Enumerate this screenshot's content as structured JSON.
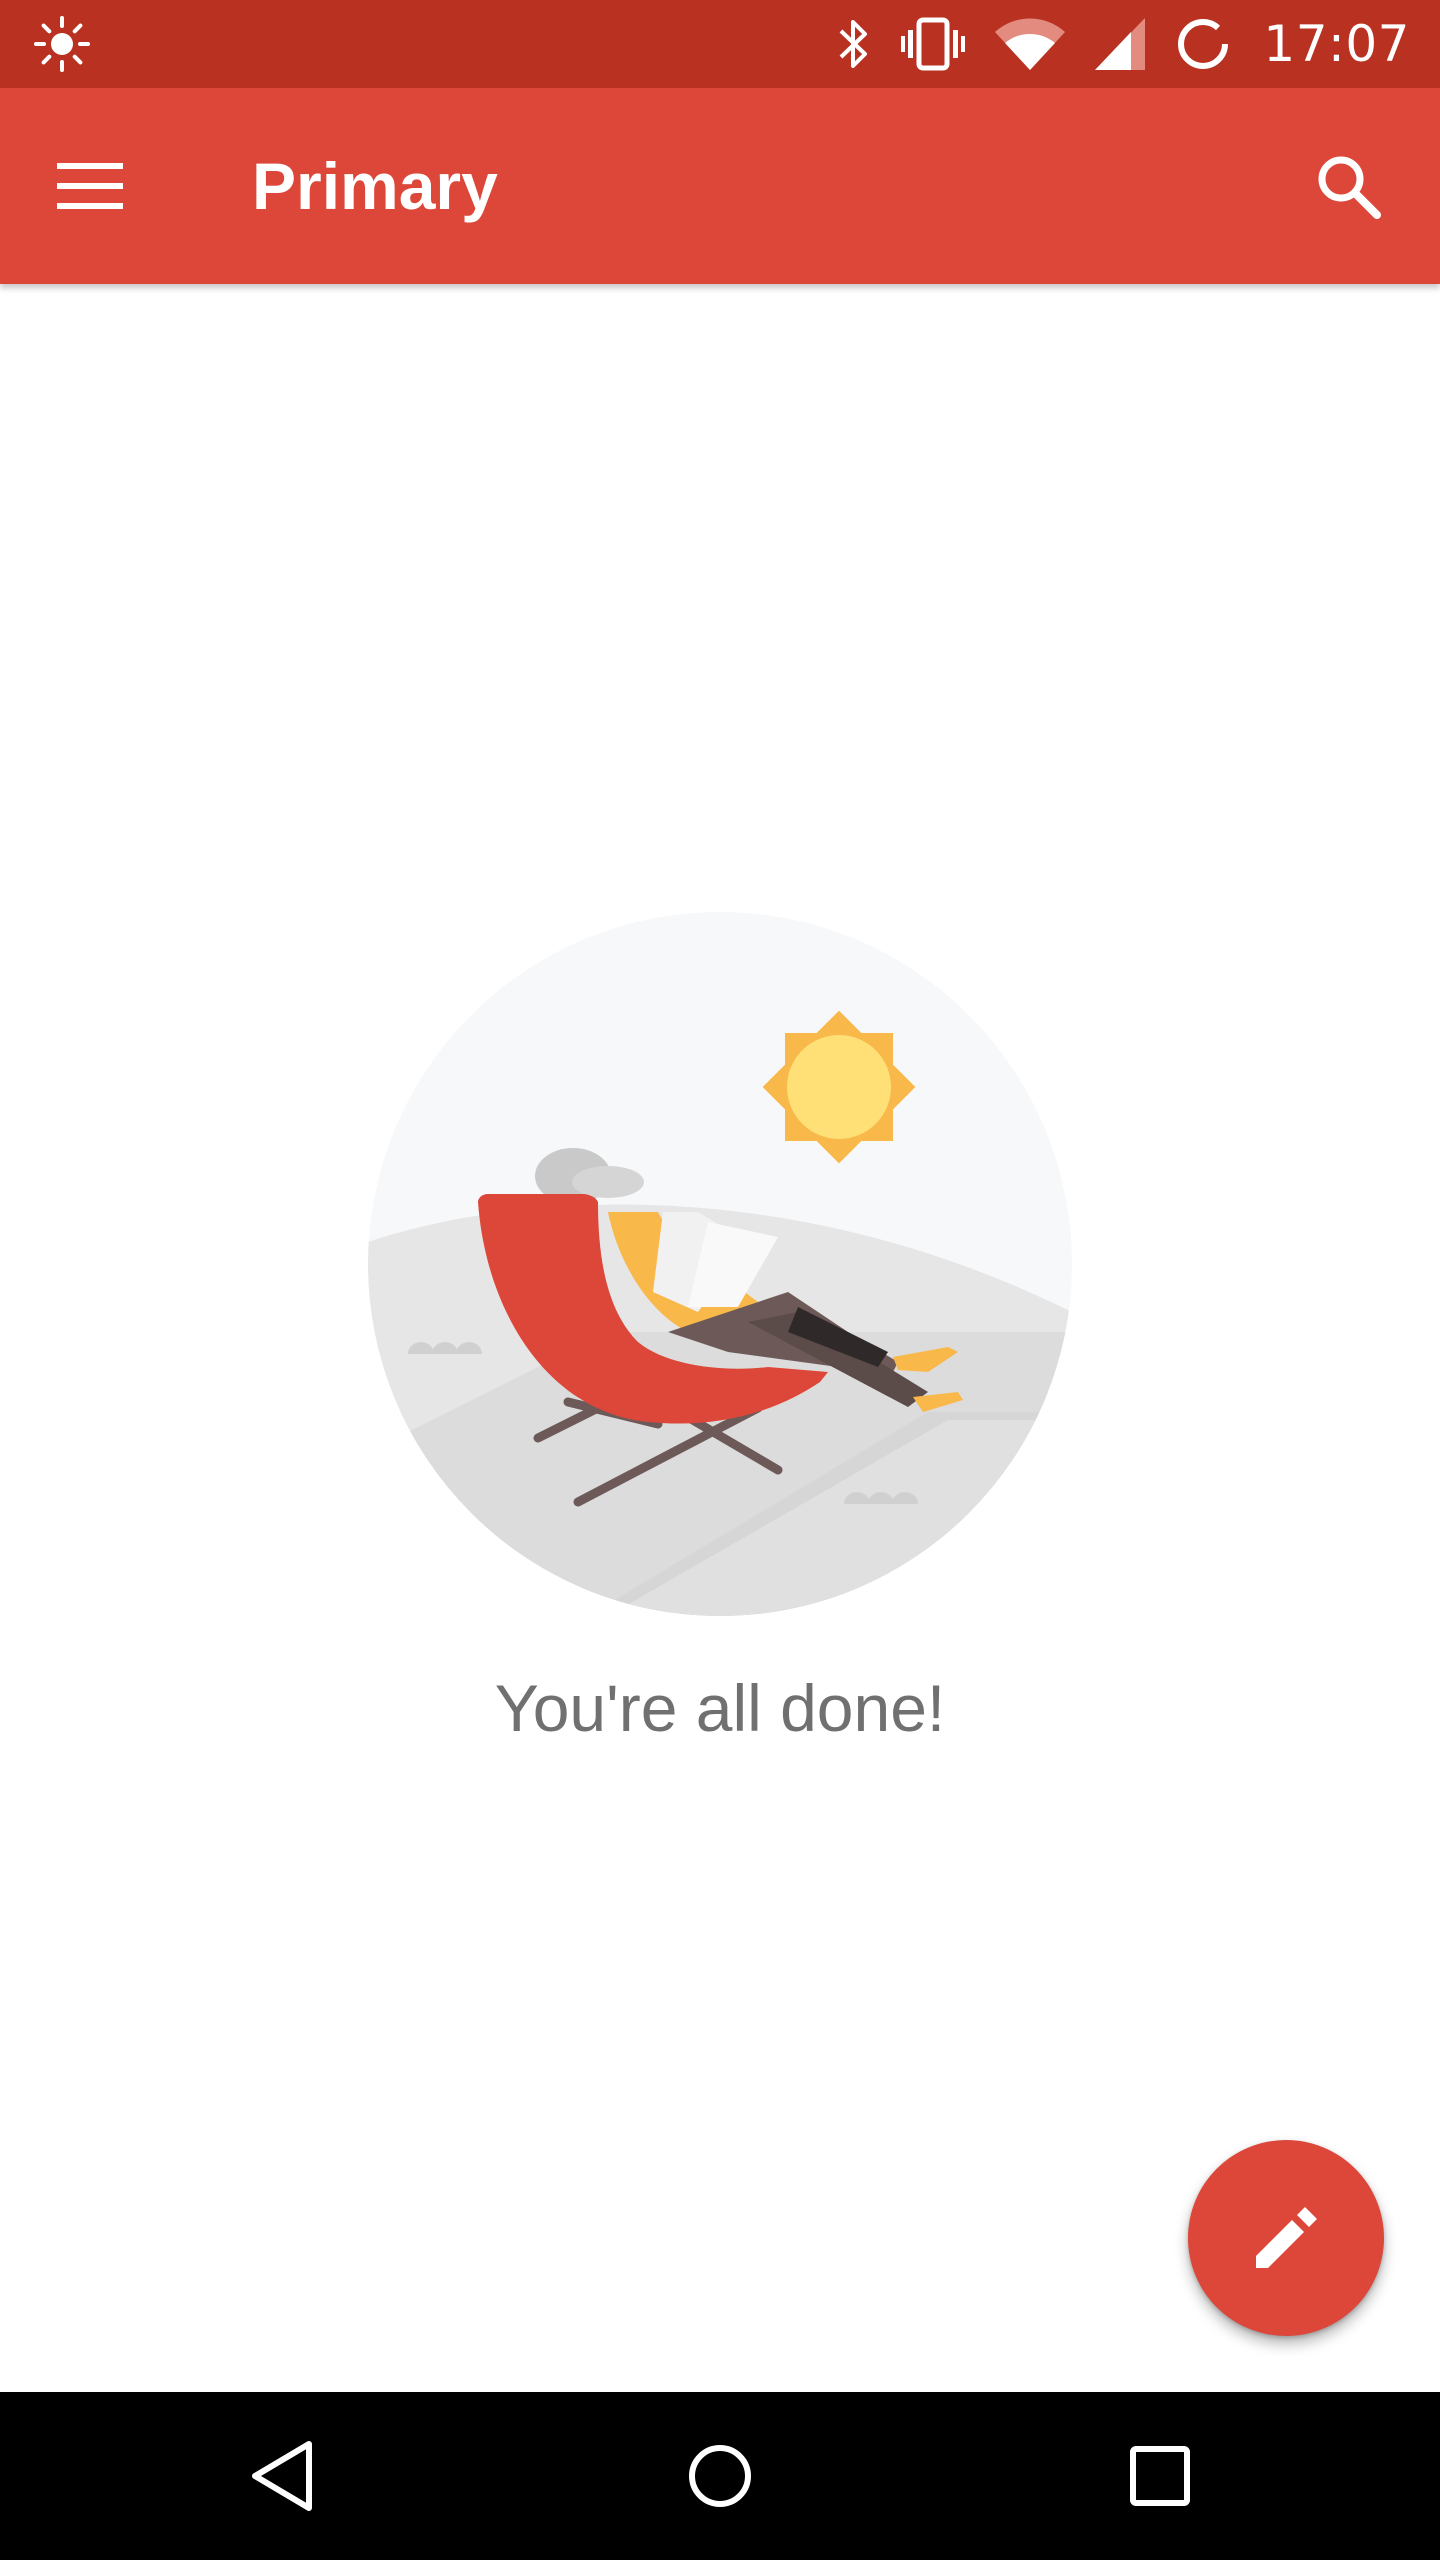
{
  "status_bar": {
    "time": "17:07",
    "left_icon": "brightness-icon",
    "icons": [
      "bluetooth-icon",
      "vibrate-icon",
      "wifi-icon",
      "cell-signal-icon",
      "sync-icon"
    ]
  },
  "app_bar": {
    "title": "Primary",
    "menu_icon": "hamburger-menu-icon",
    "search_icon": "search-icon",
    "color": "#dc473a"
  },
  "empty_state": {
    "message": "You're all done!",
    "illustration": "person-relaxing-in-deck-chair-illustration"
  },
  "fab": {
    "icon": "pencil-icon",
    "color": "#dc473a"
  },
  "nav_bar": {
    "buttons": [
      "back-icon",
      "home-icon",
      "recents-icon"
    ]
  },
  "colors": {
    "status_bar": "#b93221",
    "accent": "#dc473a",
    "text_muted": "#707070"
  }
}
